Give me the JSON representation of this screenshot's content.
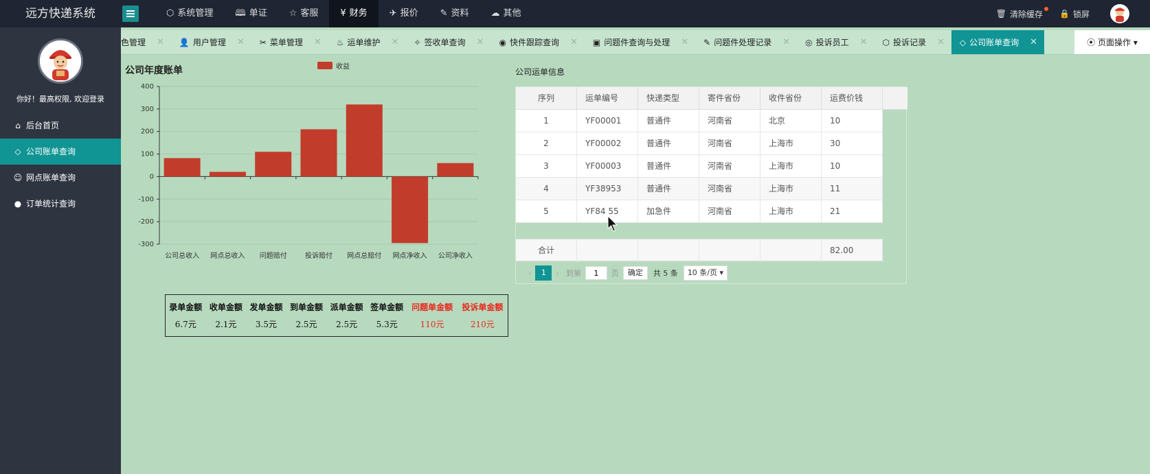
{
  "app": {
    "title": "远方快递系统"
  },
  "topnav": {
    "items": [
      {
        "label": "系统管理",
        "icon": "cube-icon"
      },
      {
        "label": "单证",
        "icon": "book-icon"
      },
      {
        "label": "客服",
        "icon": "star-icon"
      },
      {
        "label": "财务",
        "icon": "yen-icon",
        "active": true
      },
      {
        "label": "报价",
        "icon": "plane-icon"
      },
      {
        "label": "资料",
        "icon": "edit-icon"
      },
      {
        "label": "其他",
        "icon": "cloud-upload-icon"
      }
    ],
    "clear_cache": "清除缓存",
    "lock_screen": "锁屏"
  },
  "sidebar": {
    "greeting": "你好！最高权限, 欢迎登录",
    "items": [
      {
        "label": "后台首页",
        "icon": "home-icon"
      },
      {
        "label": "公司账单查询",
        "icon": "diamond-icon",
        "active": true
      },
      {
        "label": "网点账单查询",
        "icon": "smile-icon"
      },
      {
        "label": "订单统计查询",
        "icon": "circle-icon"
      }
    ]
  },
  "tabs": {
    "items": [
      {
        "label": "色管理",
        "icon": ""
      },
      {
        "label": "用户管理",
        "icon": "user-icon"
      },
      {
        "label": "菜单管理",
        "icon": "tools-icon"
      },
      {
        "label": "运单维护",
        "icon": "fire-icon"
      },
      {
        "label": "签收单查询",
        "icon": "sign-icon"
      },
      {
        "label": "快件跟踪查询",
        "icon": "github-icon"
      },
      {
        "label": "问题件查询与处理",
        "icon": "square-icon"
      },
      {
        "label": "问题件处理记录",
        "icon": "edit-icon"
      },
      {
        "label": "投诉员工",
        "icon": "circle-badge-icon"
      },
      {
        "label": "投诉记录",
        "icon": "cube-icon"
      },
      {
        "label": "公司账单查询",
        "icon": "diamond-icon",
        "active": true
      }
    ],
    "page_ops": "页面操作"
  },
  "chart": {
    "title": "公司年度账单",
    "legend": "收益"
  },
  "chart_data": {
    "type": "bar",
    "title": "公司年度账单",
    "categories": [
      "公司总收入",
      "网点总收入",
      "问题赔付",
      "投诉赔付",
      "网点总赔付",
      "网点净收入",
      "公司净收入"
    ],
    "series": [
      {
        "name": "收益",
        "values": [
          82,
          21,
          110,
          210,
          320,
          -295,
          60
        ]
      }
    ],
    "ylim": [
      -300,
      400
    ],
    "yticks": [
      "400",
      "300",
      "200",
      "100",
      "0",
      "-100",
      "-200",
      "-300"
    ],
    "grid": true,
    "legend": "top-center",
    "color": "#c23c2c"
  },
  "summary": {
    "headers": [
      "录单金额",
      "收单金额",
      "发单金额",
      "到单金额",
      "派单金额",
      "签单金额",
      "问题单金额",
      "投诉单金额"
    ],
    "values": [
      "6.7元",
      "2.1元",
      "3.5元",
      "2.5元",
      "2.5元",
      "5.3元",
      "110元",
      "210元"
    ]
  },
  "grid": {
    "title": "公司运单信息",
    "headers": [
      "序列",
      "运单编号",
      "快递类型",
      "寄件省份",
      "收件省份",
      "运费价钱"
    ],
    "rows": [
      [
        "1",
        "YF00001",
        "普通件",
        "河南省",
        "北京",
        "10"
      ],
      [
        "2",
        "YF00002",
        "普通件",
        "河南省",
        "上海市",
        "30"
      ],
      [
        "3",
        "YF00003",
        "普通件",
        "河南省",
        "上海市",
        "10"
      ],
      [
        "4",
        "YF38953",
        "普通件",
        "河南省",
        "上海市",
        "11"
      ],
      [
        "5",
        "YF84 55",
        "加急件",
        "河南省",
        "上海市",
        "21"
      ]
    ],
    "total_label": "合计",
    "total_value": "82.00"
  },
  "pager": {
    "current": "1",
    "goto_label": "到第",
    "input_value": "1",
    "page_label": "页",
    "confirm": "确定",
    "total": "共 5 条",
    "page_size": "10 条/页"
  },
  "colors": {
    "accent": "#109494",
    "bar": "#c23c2c",
    "topbar": "#1f2533",
    "sidebar": "#2f3441",
    "content_bg": "#b7dabe"
  }
}
